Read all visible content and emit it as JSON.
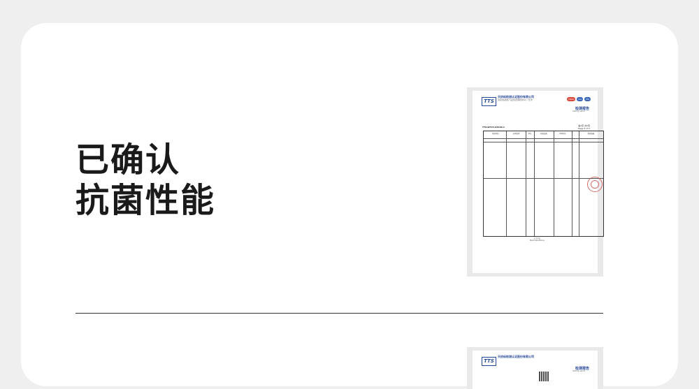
{
  "headline": {
    "line1": "已确认",
    "line2": "抗菌性能"
  },
  "report": {
    "company_cn": "天纺标检测认证股份有限公司",
    "company_addr": "国家纺织服装产品质量监督检验中心（天津）",
    "logo_text": "TTS",
    "title_cn": "检测报告",
    "title_en": "Testing report",
    "report_no": "TTS-WT24-04240-1",
    "page_no": "第2页 共2页",
    "page_en": "Page 2 of 2",
    "footer_cn": "以下空白",
    "footer_en": "Blank Pass Below",
    "col_headers": [
      "检验项目",
      "技术要求",
      "单位",
      "检验结果",
      "单项判定",
      "检验依据"
    ],
    "marks": [
      {
        "label": "CNAS",
        "color": "#d94a3a"
      },
      {
        "label": "ilac",
        "color": "#3a66b8"
      },
      {
        "label": "MA",
        "color": "#3a66b8"
      }
    ]
  },
  "report2": {
    "company_cn": "天纺标检测认证股份有限公司",
    "logo_text": "TTS",
    "title_cn": "检测报告",
    "title_en": "Testing report"
  }
}
